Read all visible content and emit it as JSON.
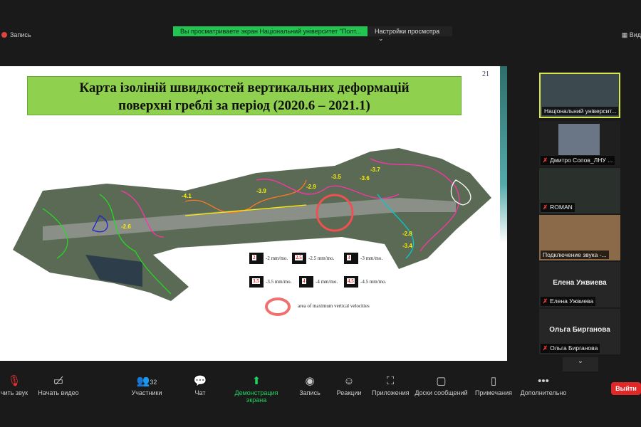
{
  "top": {
    "recording": "Запись",
    "banner": "Вы просматриваете экран Національний університет \"Полт...",
    "view_settings": "Настройки просмотра",
    "view": "Вид"
  },
  "slide": {
    "number": "21",
    "title_line1": "Карта ізоліній швидкостей вертикальних деформацій",
    "title_line2": "поверхні греблі за період (2020.6 – 2021.1)",
    "legend": [
      {
        "badge": "2",
        "text": "-2 mm/mo."
      },
      {
        "badge": "2.5",
        "text": "-2.5 mm/mo."
      },
      {
        "badge": "3",
        "text": "-3 mm/mo."
      },
      {
        "badge": "3.5",
        "text": "-3.5 mm/mo."
      },
      {
        "badge": "4",
        "text": "-4 mm/mo."
      },
      {
        "badge": "4.5",
        "text": "-4.5 mm/mo."
      }
    ],
    "legend_circle": "area of maximum vertical velocities",
    "map_labels": [
      "-4.1",
      "-3.9",
      "-3.5",
      "-3.6",
      "-3.7",
      "-2.8",
      "-2.6",
      "-2.9",
      "-3.4"
    ]
  },
  "participants": [
    {
      "name": "Національний університ...",
      "muted": false
    },
    {
      "name": "Дмитро Сопов_ЛНУ ...",
      "muted": true
    },
    {
      "name": "ROMAN",
      "muted": true
    },
    {
      "name": "Подключение звука -...",
      "muted": false
    },
    {
      "name": "Елена Ужвиева",
      "big": "Елена Ужвиева",
      "muted": true
    },
    {
      "name": "Ольга Бирганова",
      "big": "Ольга Бирганова",
      "muted": true
    }
  ],
  "toolbar": {
    "mute": "чить звук",
    "video": "Начать видео",
    "participants": "Участники",
    "participants_count": "32",
    "chat": "Чат",
    "share": "Демонстрация экрана",
    "record": "Запись",
    "reactions": "Реакции",
    "apps": "Приложения",
    "whiteboards": "Доски сообщений",
    "notes": "Примечания",
    "more": "Дополнительно",
    "exit": "Выйти"
  }
}
